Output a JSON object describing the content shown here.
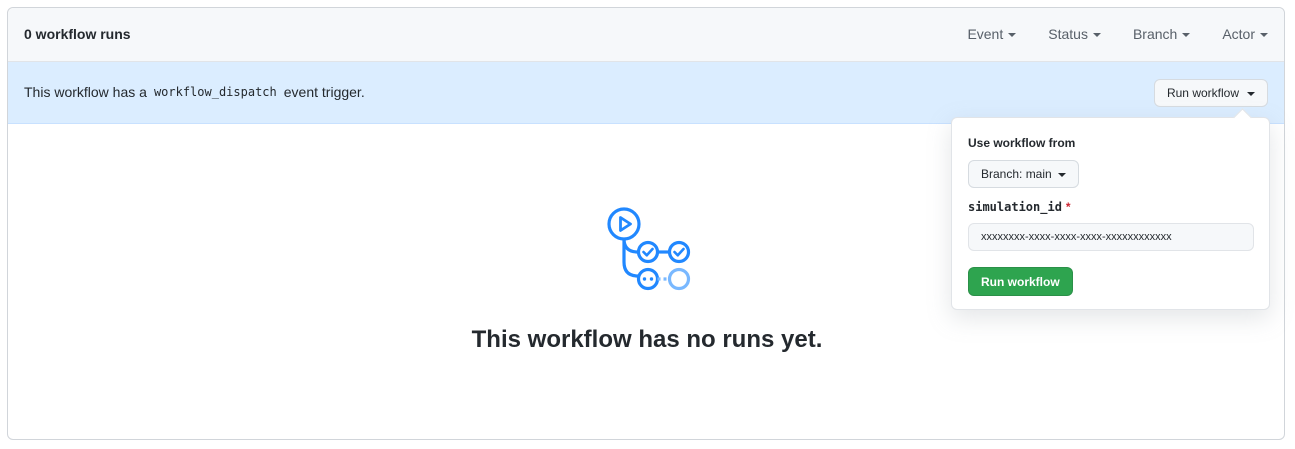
{
  "header": {
    "runs_count": "0 workflow runs",
    "filters": [
      "Event",
      "Status",
      "Branch",
      "Actor"
    ]
  },
  "dispatch": {
    "text_before": "This workflow has a",
    "code": "workflow_dispatch",
    "text_after": "event trigger.",
    "run_button_label": "Run workflow"
  },
  "popover": {
    "title": "Use workflow from",
    "branch_button_label": "Branch: main",
    "field_label": "simulation_id",
    "required_marker": "*",
    "field_value": "xxxxxxxx-xxxx-xxxx-xxxx-xxxxxxxxxxxx",
    "submit_label": "Run workflow"
  },
  "empty_state": {
    "icon": "workflow-icon",
    "title": "This workflow has no runs yet."
  },
  "colors": {
    "accent_blue": "#2188ff",
    "dispatch_bg": "#dbedff",
    "green_button": "#2ea44f",
    "required_red": "#cb2431"
  }
}
